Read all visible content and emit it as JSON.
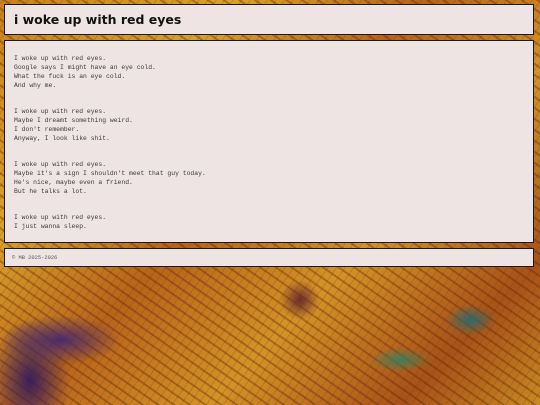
{
  "header": {
    "title": "i woke up with red eyes"
  },
  "poem": {
    "stanzas": [
      {
        "lines": [
          "I woke up with red eyes.",
          "Google says I might have an eye cold.",
          "What the fuck is an eye cold.",
          "And why me."
        ]
      },
      {
        "lines": [
          "I woke up with red eyes.",
          "Maybe I dreamt something weird.",
          "I don't remember.",
          "Anyway, I look like shit."
        ]
      },
      {
        "lines": [
          "I woke up with red eyes.",
          "Maybe it's a sign I shouldn't meet that guy today.",
          "He's nice, maybe even a friend.",
          "But he talks a lot."
        ]
      },
      {
        "lines": [
          "I woke up with red eyes.",
          "I just wanna sleep."
        ]
      }
    ]
  },
  "footer": {
    "copyright": "© MB 2025-2026"
  }
}
